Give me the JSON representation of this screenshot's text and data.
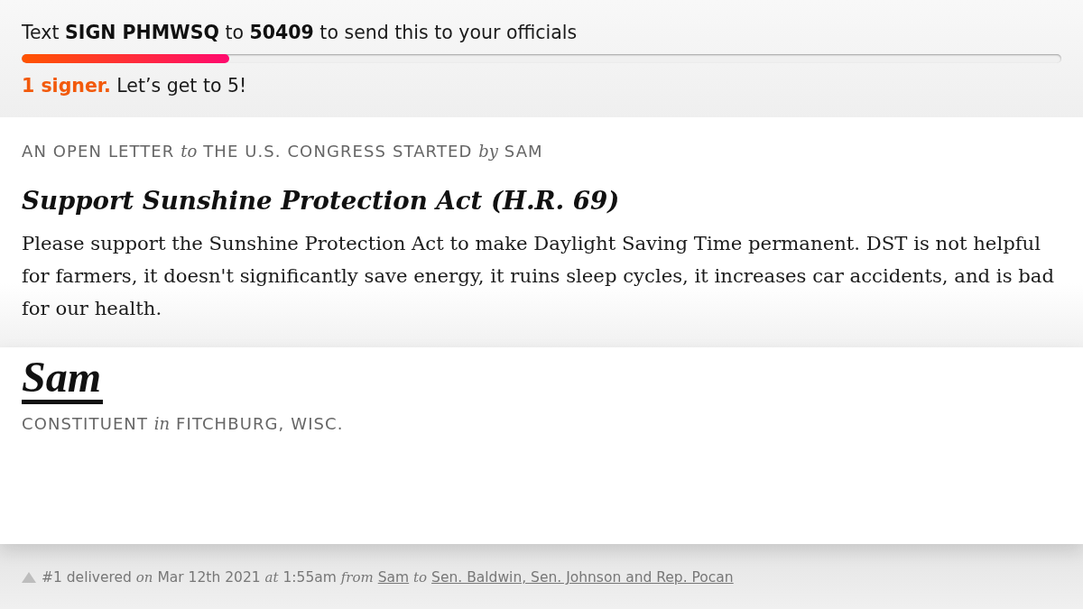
{
  "sms_prompt": {
    "text": "Text **SIGN PHMWSQ** to **50409** to send this to your officials"
  },
  "progress": {
    "level": 0.2,
    "caption": "**1 signer.** Let’s get to 5!"
  },
  "letter": {
    "eyebrow": "AN OPEN LETTER *to* THE U.S. CONGRESS STARTED *by* SAM",
    "title": "Support Sunshine Protection Act (H.R. 69)",
    "body": "Please support the Sunshine Protection Act to make Daylight Saving Time permanent. DST is not helpful for farmers, it doesn't significantly save energy, it ruins sleep cycles, it increases car accidents, and is bad for our health."
  },
  "signature": {
    "name": "Sam",
    "byline": "CONSTITUENT *in* FITCHBURG, WISC."
  },
  "delivery": {
    "parts": [
      {
        "kind": "text",
        "text": "#1 delivered *on* Mar 12th 2021 *at* 1:55am *from*"
      },
      {
        "kind": "link",
        "text": "Sam"
      },
      {
        "kind": "text",
        "text": "*to*"
      },
      {
        "kind": "link",
        "text": "Sen. Baldwin, Sen. Johnson and Rep. Pocan"
      }
    ]
  }
}
